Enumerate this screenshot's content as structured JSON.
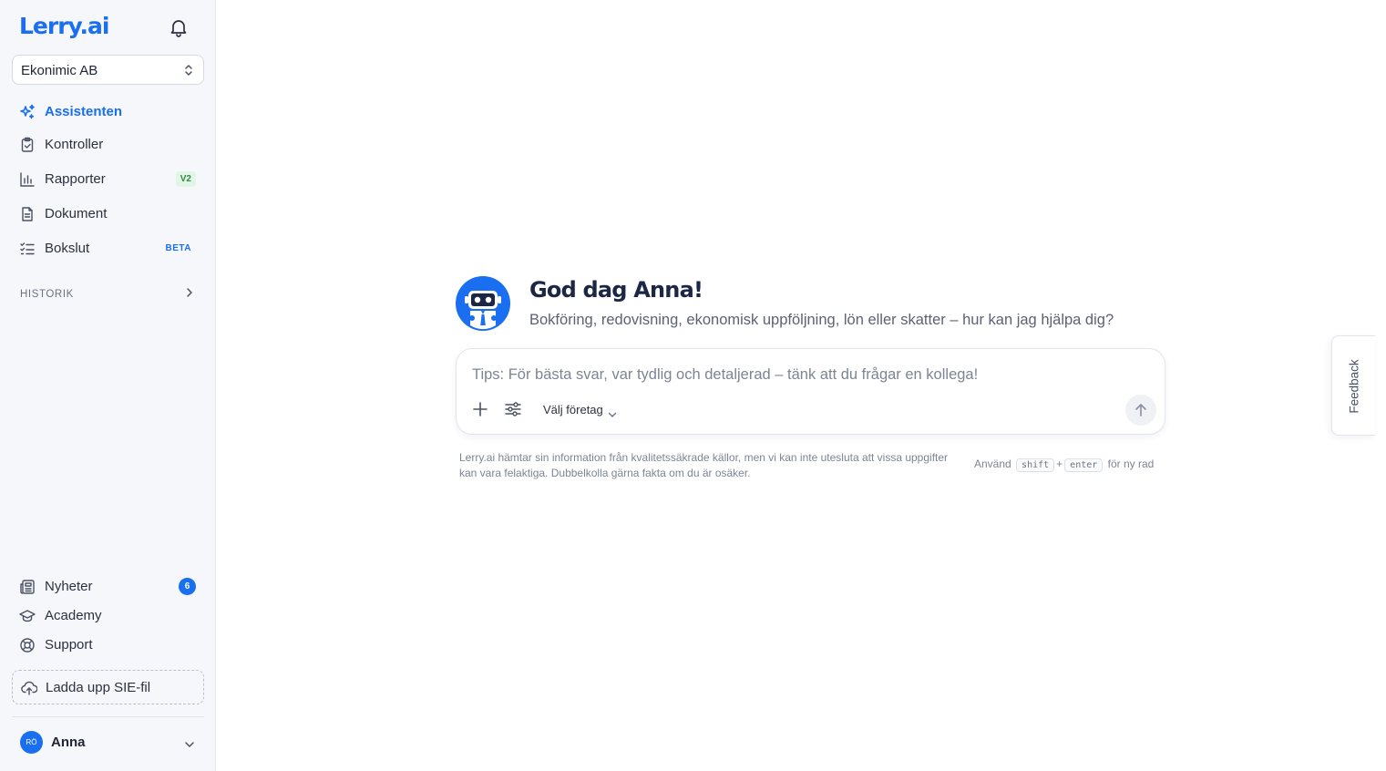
{
  "brand": {
    "logo_text": "Lerry.ai",
    "accent": "#1a6ef0"
  },
  "sidebar": {
    "company_select": {
      "value": "Ekonimic AB"
    },
    "nav": [
      {
        "label": "Assistenten",
        "icon": "sparkle-icon",
        "active": true
      },
      {
        "label": "Kontroller",
        "icon": "clipboard-check-icon"
      },
      {
        "label": "Rapporter",
        "icon": "bar-chart-icon",
        "badge": "V2"
      },
      {
        "label": "Dokument",
        "icon": "document-icon"
      },
      {
        "label": "Bokslut",
        "icon": "checklist-icon",
        "badge": "BETA"
      }
    ],
    "history_label": "HISTORIK",
    "bottom_nav": [
      {
        "label": "Nyheter",
        "icon": "newspaper-icon",
        "count": "6"
      },
      {
        "label": "Academy",
        "icon": "graduation-cap-icon"
      },
      {
        "label": "Support",
        "icon": "lifebuoy-icon"
      }
    ],
    "upload_label": "Ladda upp SIE-fil",
    "user": {
      "initials": "RÖ",
      "name": "Anna"
    }
  },
  "main": {
    "greeting_title": "God dag Anna!",
    "greeting_subtitle": "Bokföring, redovisning, ekonomisk uppföljning, lön eller skatter – hur kan jag hjälpa dig?",
    "chat": {
      "placeholder": "Tips: För bästa svar, var tydlig och detaljerad – tänk att du frågar en kollega!",
      "company_dropdown": "Välj företag"
    },
    "disclaimer": "Lerry.ai hämtar sin information från kvalitetssäkrade källor, men vi kan inte utesluta att vissa uppgifter kan vara felaktiga. Dubbelkolla gärna fakta om du är osäker.",
    "hint": {
      "prefix": "Använd",
      "key1": "shift",
      "plus": "+",
      "key2": "enter",
      "suffix": "för ny rad"
    }
  },
  "feedback_label": "Feedback"
}
